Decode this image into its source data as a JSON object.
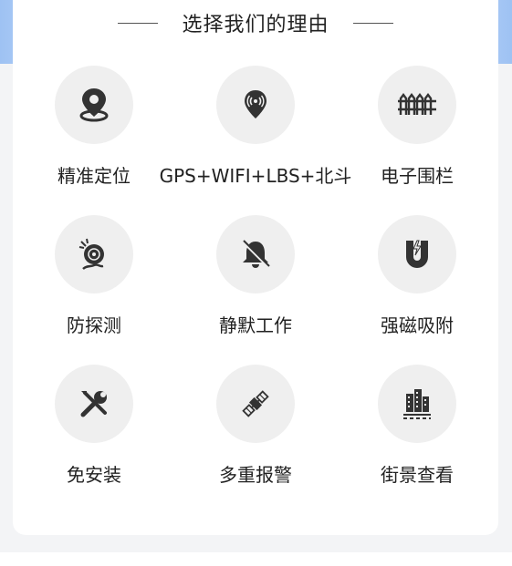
{
  "section": {
    "title": "选择我们的理由"
  },
  "features": [
    {
      "label": "精准定位",
      "icon": "location-pin-icon"
    },
    {
      "label": "GPS+WIFI+LBS+北斗",
      "icon": "signal-pin-icon"
    },
    {
      "label": "电子围栏",
      "icon": "fence-icon"
    },
    {
      "label": "防探测",
      "icon": "anti-detection-icon"
    },
    {
      "label": "静默工作",
      "icon": "muted-bell-icon"
    },
    {
      "label": "强磁吸附",
      "icon": "magnet-icon"
    },
    {
      "label": "免安装",
      "icon": "tools-icon"
    },
    {
      "label": "多重报警",
      "icon": "satellite-icon"
    },
    {
      "label": "街景查看",
      "icon": "street-view-icon"
    }
  ],
  "colors": {
    "icon_fill": "#333333",
    "circle_bg": "#efefef",
    "text": "#222222"
  }
}
